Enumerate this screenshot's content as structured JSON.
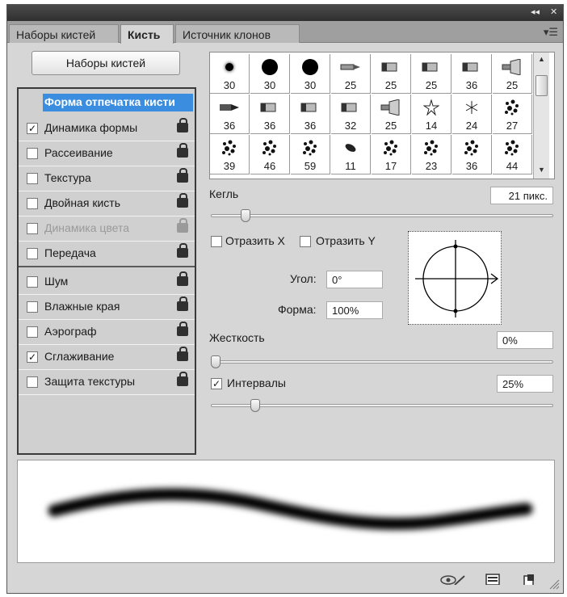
{
  "topbar": {
    "collapse_glyph": "◂◂",
    "close_glyph": "✕"
  },
  "tabs": [
    {
      "label": "Наборы кистей",
      "active": false
    },
    {
      "label": "Кисть",
      "active": true
    },
    {
      "label": "Источник клонов",
      "active": false
    }
  ],
  "tab_menu_glyph": "▾☰",
  "presets_button": "Наборы кистей",
  "options_header": "Форма отпечатка кисти",
  "options": [
    {
      "label": "Динамика формы",
      "checked": true,
      "disabled": false
    },
    {
      "label": "Рассеивание",
      "checked": false,
      "disabled": false
    },
    {
      "label": "Текстура",
      "checked": false,
      "disabled": false
    },
    {
      "label": "Двойная кисть",
      "checked": false,
      "disabled": false
    },
    {
      "label": "Динамика цвета",
      "checked": false,
      "disabled": true
    },
    {
      "label": "Передача",
      "checked": false,
      "disabled": false
    },
    {
      "label": "Шум",
      "checked": false,
      "disabled": false
    },
    {
      "label": "Влажные края",
      "checked": false,
      "disabled": false
    },
    {
      "label": "Аэрограф",
      "checked": false,
      "disabled": false
    },
    {
      "label": "Сглаживание",
      "checked": true,
      "disabled": false
    },
    {
      "label": "Защита текстуры",
      "checked": false,
      "disabled": false
    }
  ],
  "check_glyph": "✓",
  "brush_tips": [
    {
      "size": "30",
      "icon": "soft-round"
    },
    {
      "size": "30",
      "icon": "hard-round"
    },
    {
      "size": "30",
      "icon": "hard-round"
    },
    {
      "size": "25",
      "icon": "airbrush"
    },
    {
      "size": "25",
      "icon": "chalk"
    },
    {
      "size": "25",
      "icon": "chalk"
    },
    {
      "size": "36",
      "icon": "chalk"
    },
    {
      "size": "25",
      "icon": "airbrush-pen"
    },
    {
      "size": "36",
      "icon": "marker"
    },
    {
      "size": "36",
      "icon": "chalk"
    },
    {
      "size": "36",
      "icon": "chalk"
    },
    {
      "size": "32",
      "icon": "chalk"
    },
    {
      "size": "25",
      "icon": "airbrush-pen"
    },
    {
      "size": "14",
      "icon": "star"
    },
    {
      "size": "24",
      "icon": "dune-grass"
    },
    {
      "size": "27",
      "icon": "scattered"
    },
    {
      "size": "39",
      "icon": "scattered"
    },
    {
      "size": "46",
      "icon": "scattered"
    },
    {
      "size": "59",
      "icon": "scattered"
    },
    {
      "size": "11",
      "icon": "leaf"
    },
    {
      "size": "17",
      "icon": "scattered"
    },
    {
      "size": "23",
      "icon": "scattered"
    },
    {
      "size": "36",
      "icon": "scattered"
    },
    {
      "size": "44",
      "icon": "scattered"
    }
  ],
  "size": {
    "label": "Кегль",
    "value": "21 пикс.",
    "fraction": 0.09
  },
  "flip_x": {
    "label": "Отразить X",
    "checked": false
  },
  "flip_y": {
    "label": "Отразить Y",
    "checked": false
  },
  "angle": {
    "label": "Угол:",
    "value": "0°"
  },
  "roundness": {
    "label": "Форма:",
    "value": "100%"
  },
  "hardness": {
    "label": "Жесткость",
    "value": "0%",
    "fraction": 0.0
  },
  "spacing": {
    "label": "Интервалы",
    "checked": true,
    "value": "25%",
    "fraction": 0.12
  },
  "bottom_icons": [
    "eye-brush-icon",
    "panel-icon",
    "new-preset-icon",
    "resize-grip-icon"
  ]
}
